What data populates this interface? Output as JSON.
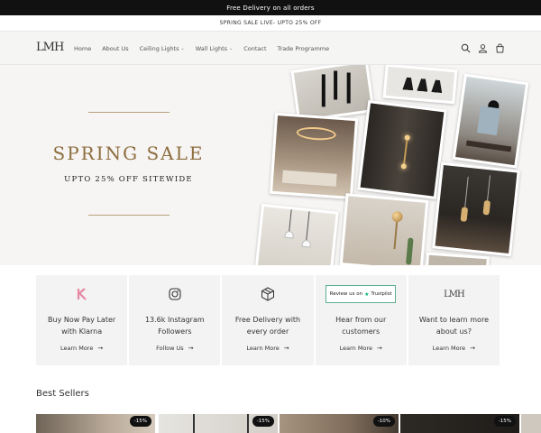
{
  "announcement": {
    "text": "Free Delivery on all orders"
  },
  "promo": {
    "text": "SPRING SALE LIVE- UPTO 25% OFF"
  },
  "header": {
    "logo": "LMH",
    "nav": [
      {
        "label": "Home",
        "has_dropdown": false
      },
      {
        "label": "About Us",
        "has_dropdown": false
      },
      {
        "label": "Ceiling Lights",
        "has_dropdown": true
      },
      {
        "label": "Wall Lights",
        "has_dropdown": true
      },
      {
        "label": "Contact",
        "has_dropdown": false
      },
      {
        "label": "Trade Programme",
        "has_dropdown": false
      }
    ],
    "icons": [
      "search-icon",
      "account-icon",
      "cart-icon"
    ]
  },
  "hero": {
    "title": "SPRING SALE",
    "subtitle": "UPTO 25% OFF SITEWIDE",
    "accent_color": "#8d6d3f"
  },
  "features": [
    {
      "icon": "klarna-icon",
      "text": "Buy Now Pay Later with Klarna",
      "link": "Learn More"
    },
    {
      "icon": "instagram-icon",
      "text": "13.6k Instagram Followers",
      "link": "Follow Us"
    },
    {
      "icon": "package-icon",
      "text": "Free Delivery with every order",
      "link": "Learn More"
    },
    {
      "icon": "trustpilot-icon",
      "badge_text": "Review us on",
      "badge_brand": "Trustpilot",
      "text": "Hear from our customers",
      "link": "Learn More"
    },
    {
      "icon": "lmh-logo-icon",
      "logo_text": "LMH",
      "text": "Want to learn more about us?",
      "link": "Learn More"
    }
  ],
  "best_sellers": {
    "title": "Best Sellers",
    "products": [
      {
        "badge": "-15%"
      },
      {
        "badge": "-15%"
      },
      {
        "badge": "-10%"
      },
      {
        "badge": "-15%"
      }
    ]
  }
}
